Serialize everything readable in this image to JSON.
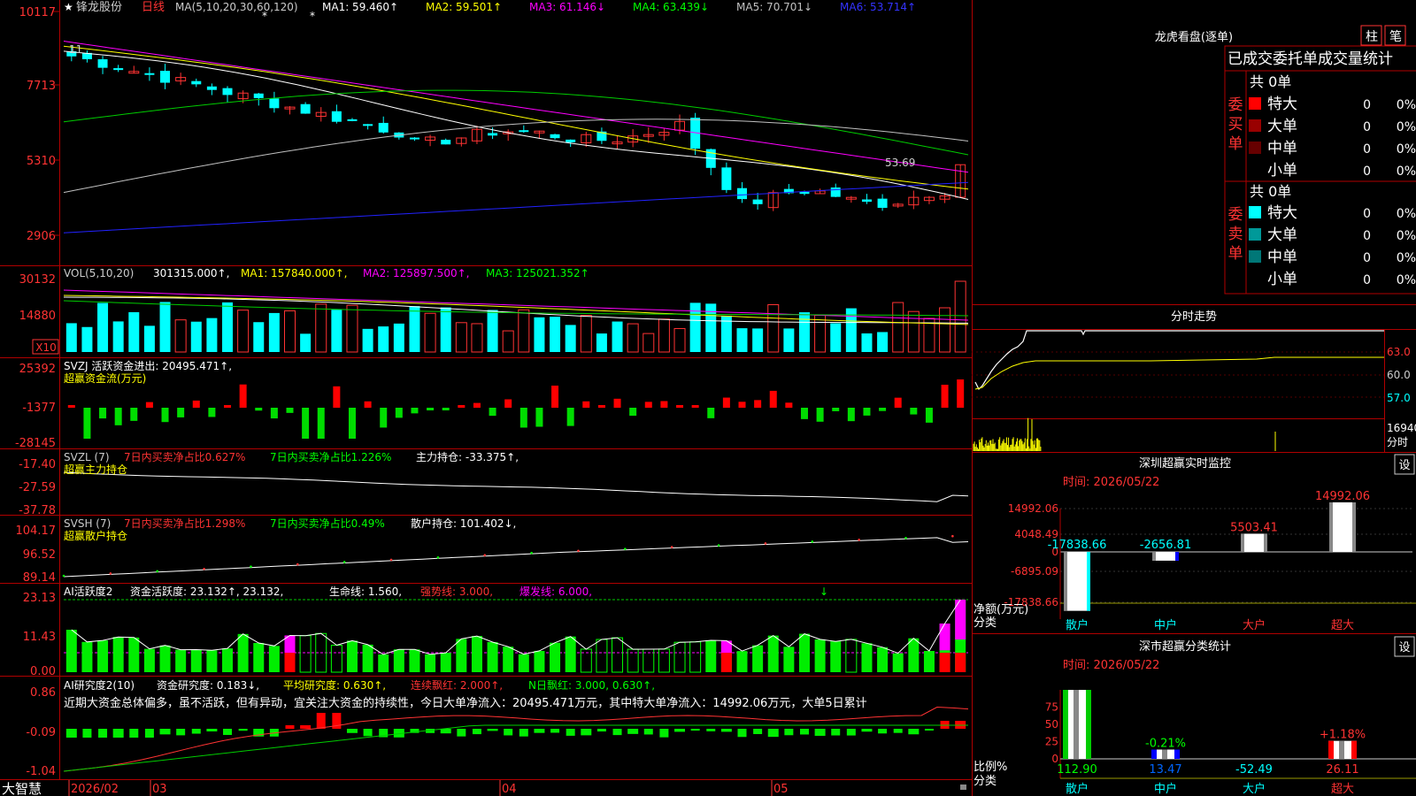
{
  "app": {
    "brand": "大智慧"
  },
  "stock": {
    "name": "锋龙股份",
    "period": "日线"
  },
  "main_panel": {
    "ma_header": "MA(5,10,20,30,60,120)",
    "ma_values": [
      {
        "label": "MA1:",
        "value": "59.460",
        "arrow": "↑",
        "color": "#ffffff"
      },
      {
        "label": "MA2:",
        "value": "59.501",
        "arrow": "↑",
        "color": "#ffff00"
      },
      {
        "label": "MA3:",
        "value": "61.146",
        "arrow": "↓",
        "color": "#ff00ff"
      },
      {
        "label": "MA4:",
        "value": "63.439",
        "arrow": "↓",
        "color": "#00ff00"
      },
      {
        "label": "MA5:",
        "value": "70.701",
        "arrow": "↓",
        "color": "#c0c0c0"
      },
      {
        "label": "MA6:",
        "value": "53.714",
        "arrow": "↑",
        "color": "#3333ff"
      }
    ],
    "price_labels": [
      "10117",
      "7713",
      "5310",
      "2906"
    ],
    "annotations": {
      "high": "11",
      "low": "53.69"
    }
  },
  "vol_panel": {
    "header": "VOL(5,10,20)",
    "value": "301315.000",
    "ma1": "MA1: 157840.000",
    "ma2": "MA2: 125897.500",
    "ma3": "MA3: 125021.352",
    "axis": [
      "30132",
      "14880"
    ],
    "unit": "X10"
  },
  "svzj_panel": {
    "header": "SVZJ  活跃资金进出: 20495.471↑,",
    "subtitle": "超赢资金流(万元)",
    "axis": [
      "25392",
      "-1377",
      "-28145"
    ]
  },
  "svzl_panel": {
    "name": "SVZL (7)",
    "t1": "7日内买卖净占比0.627%",
    "t2": "7日内买卖净占比1.226%",
    "t3": "主力持仓: -33.375↑,",
    "subtitle": "超赢主力持仓",
    "axis": [
      "-17.40",
      "-27.59",
      "-37.78"
    ]
  },
  "svsh_panel": {
    "name": "SVSH (7)",
    "t1": "7日内买卖净占比1.298%",
    "t2": "7日内买卖净占比0.49%",
    "t3": "散户持仓: 101.402↓,",
    "subtitle": "超赢散户持仓",
    "axis": [
      "104.17",
      "96.52",
      "89.14"
    ]
  },
  "ai1_panel": {
    "name": "AI活跃度2",
    "t1": "资金活跃度: 23.132↑, 23.132,",
    "t2": "生命线: 1.560,",
    "t3": "强势线: 3.000,",
    "t4": "爆发线: 6.000,",
    "axis": [
      "23.13",
      "11.43",
      "0.00"
    ]
  },
  "ai2_panel": {
    "name": "AI研究度2(10)",
    "t1": "资金研究度: 0.183↓,",
    "t2": "平均研究度: 0.630↑,",
    "t3": "连续飘红: 2.000↑,",
    "t4": "N日飘红: 3.000, 0.630↑,",
    "axis": [
      "0.86",
      "-0.09",
      "-1.04"
    ],
    "comment": "近期大资金总体偏多，虽不活跃，但有异动，宜关注大资金的持续性，今日大单净流入：20495.471万元，其中特大单净流入：14992.06万元，大单5日累计"
  },
  "date_axis": [
    "2026/02",
    "03",
    "04",
    "05"
  ],
  "lhb": {
    "title": "龙虎看盘(逐单)",
    "btn_bar": "柱",
    "btn_pen": "笔",
    "subtitle": "已成交委托单成交量统计",
    "buy_label": "委买单",
    "sell_label": "委卖单",
    "buy_total": "共 0单",
    "sell_total": "共 0单",
    "buy_rows": [
      {
        "name": "特大",
        "qty": "0",
        "pct": "0%",
        "color": "#ff0000"
      },
      {
        "name": "大单",
        "qty": "0",
        "pct": "0%",
        "color": "#990000"
      },
      {
        "name": "中单",
        "qty": "0",
        "pct": "0%",
        "color": "#660000"
      },
      {
        "name": "小单",
        "qty": "0",
        "pct": "0%",
        "color": "#000000"
      }
    ],
    "sell_rows": [
      {
        "name": "特大",
        "qty": "0",
        "pct": "0%",
        "color": "#00ffff"
      },
      {
        "name": "大单",
        "qty": "0",
        "pct": "0%",
        "color": "#009999"
      },
      {
        "name": "中单",
        "qty": "0",
        "pct": "0%",
        "color": "#007777"
      },
      {
        "name": "小单",
        "qty": "0",
        "pct": "0%",
        "color": "#000000"
      }
    ]
  },
  "intraday": {
    "title": "分时走势",
    "axis": [
      "63.0",
      "60.0",
      "57.0"
    ],
    "vol_label": "16940",
    "vol_unit": "分时"
  },
  "sz_monitor": {
    "title": "深圳超赢实时监控",
    "set_btn": "设",
    "time": "时间: 2026/05/22",
    "axis": [
      "14992.06",
      "4048.49",
      "0",
      "-6895.09",
      "-17838.66"
    ],
    "ylabel": "净额(万元)",
    "xlabel": "分类"
  },
  "sz_stats": {
    "title": "深市超赢分类统计",
    "set_btn": "设",
    "time": "时间: 2026/05/22",
    "axis": [
      "75",
      "50",
      "25",
      "0"
    ],
    "ylabel": "比例%",
    "xlabel": "分类"
  },
  "chart_data": [
    {
      "type": "bar",
      "title": "深圳超赢实时监控",
      "ylabel": "净额(万元)",
      "xlabel": "分类",
      "categories": [
        "散户",
        "中户",
        "大户",
        "超大"
      ],
      "values": [
        -17838.66,
        -2656.81,
        5503.41,
        14992.06
      ],
      "value_labels": [
        "-17838.66",
        "-2656.81",
        "5503.41",
        "14992.06"
      ],
      "ylim": [
        -17838.66,
        14992.06
      ]
    },
    {
      "type": "bar",
      "title": "深市超赢分类统计",
      "ylabel": "比例%",
      "xlabel": "分类",
      "categories": [
        "散户",
        "中户",
        "大户",
        "超大"
      ],
      "values": [
        112.9,
        13.47,
        -52.49,
        26.11
      ],
      "value_labels": [
        "112.90",
        "13.47",
        "-52.49",
        "26.11"
      ],
      "change_labels": [
        "",
        "-0.21%",
        "",
        "+1.18%"
      ],
      "ylim": [
        0,
        100
      ]
    }
  ]
}
